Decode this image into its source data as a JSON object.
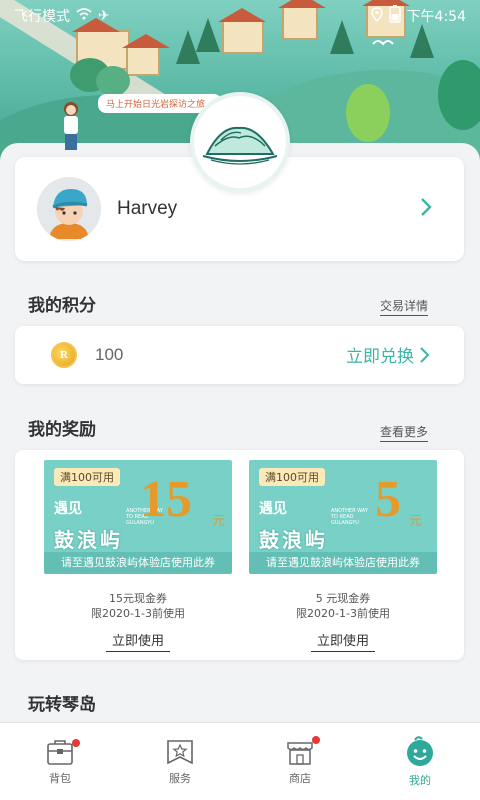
{
  "status_bar": {
    "mode": "飞行模式",
    "time": "下午4:54"
  },
  "hero": {
    "speech": "马上开始日光岩探访之旅…"
  },
  "profile": {
    "name": "Harvey"
  },
  "points_section": {
    "title": "我的积分",
    "link": "交易详情",
    "value": "100",
    "action": "立即兑换",
    "coin_letter": "R"
  },
  "rewards_section": {
    "title": "我的奖励",
    "link": "查看更多",
    "coupons": [
      {
        "tag": "满100可用",
        "amount": "15",
        "unit": "元",
        "logo_top": "遇见",
        "logo_main": "鼓浪屿",
        "tagline": "ANOTHER WAY TO READ GULANGYU",
        "strip": "请至遇见鼓浪屿体验店使用此券",
        "name": "15元现金券",
        "expiry": "限2020-1-3前使用",
        "button": "立即使用"
      },
      {
        "tag": "满100可用",
        "amount": "5",
        "unit": "元",
        "logo_top": "遇见",
        "logo_main": "鼓浪屿",
        "tagline": "ANOTHER WAY TO READ GULANGYU",
        "strip": "请至遇见鼓浪屿体验店使用此券",
        "name": "5 元现金券",
        "expiry": "限2020-1-3前使用",
        "button": "立即使用"
      }
    ]
  },
  "explore_section": {
    "title": "玩转琴岛"
  },
  "tabbar": {
    "items": [
      {
        "label": "背包",
        "icon": "backpack-icon",
        "badge": true
      },
      {
        "label": "服务",
        "icon": "service-icon",
        "badge": false
      },
      {
        "label": "商店",
        "icon": "store-icon",
        "badge": true
      },
      {
        "label": "我的",
        "icon": "profile-icon",
        "badge": false
      }
    ],
    "active_color": "#2ea89a"
  },
  "colors": {
    "accent": "#3ab5a6",
    "coupon_bg": "#79d0c6",
    "amount": "#e59a2a"
  }
}
